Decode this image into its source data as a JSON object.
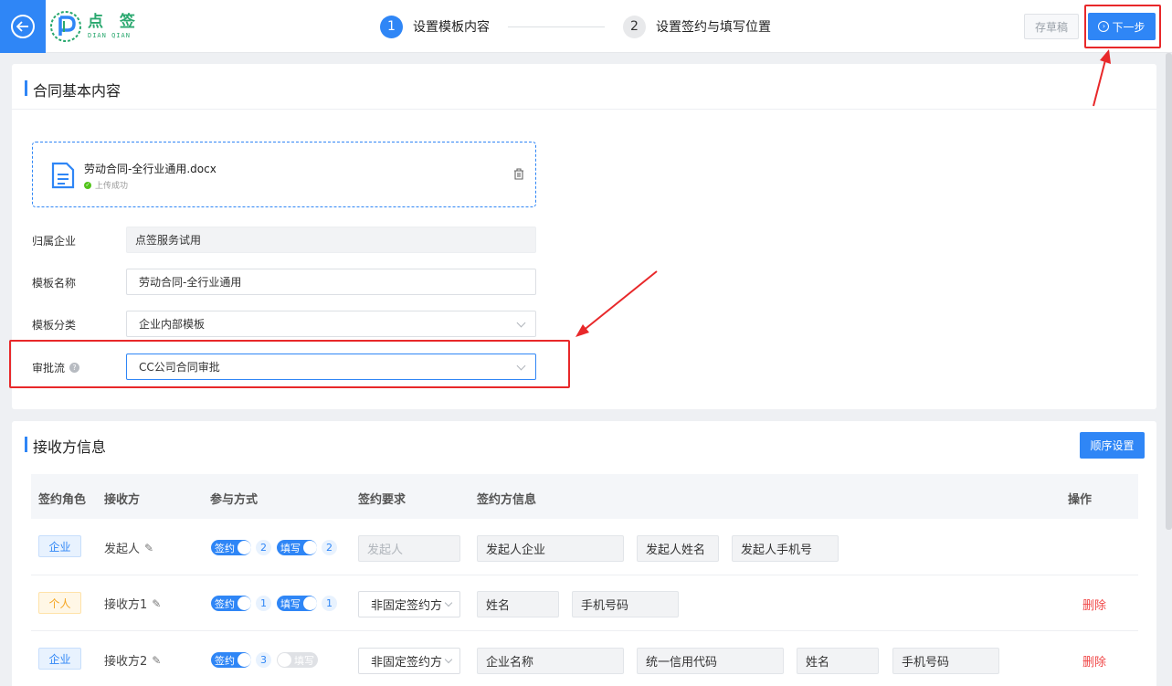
{
  "header": {
    "logo_cn": "点 签",
    "logo_en": "DIAN QIAN",
    "steps": [
      {
        "num": "1",
        "label": "设置模板内容"
      },
      {
        "num": "2",
        "label": "设置签约与填写位置"
      }
    ],
    "draft_label": "存草稿",
    "next_label": "下一步"
  },
  "basic": {
    "title": "合同基本内容",
    "file_name": "劳动合同-全行业通用.docx",
    "file_status": "上传成功",
    "fields": [
      {
        "label": "归属企业",
        "value": "点签服务试用"
      },
      {
        "label": "模板名称",
        "value": "劳动合同-全行业通用"
      },
      {
        "label": "模板分类",
        "value": "企业内部模板"
      },
      {
        "label": "审批流",
        "value": "CC公司合同审批"
      }
    ]
  },
  "recipients": {
    "title": "接收方信息",
    "order_label": "顺序设置",
    "columns": [
      "签约角色",
      "接收方",
      "参与方式",
      "签约要求",
      "签约方信息",
      "操作"
    ],
    "rows": [
      {
        "role": "企业",
        "name": "发起人",
        "sign_label": "签约",
        "sign_count": "2",
        "fill_label": "填写",
        "fill_count": "2",
        "requirement": "发起人",
        "info": [
          "发起人企业",
          "发起人姓名",
          "发起人手机号"
        ],
        "action": ""
      },
      {
        "role": "个人",
        "name": "接收方1",
        "sign_label": "签约",
        "sign_count": "1",
        "fill_label": "填写",
        "fill_count": "1",
        "requirement": "非固定签约方",
        "info": [
          "姓名",
          "手机号码"
        ],
        "action": "删除"
      },
      {
        "role": "企业",
        "name": "接收方2",
        "sign_label": "签约",
        "sign_count": "3",
        "fill_label": "填写",
        "fill_count": "",
        "requirement": "非固定签约方",
        "info": [
          "企业名称",
          "统一信用代码",
          "姓名",
          "手机号码"
        ],
        "action": "删除"
      }
    ]
  },
  "colors": {
    "accent": "#2f86f6",
    "danger": "#f04848",
    "annotation": "#e8282a"
  }
}
